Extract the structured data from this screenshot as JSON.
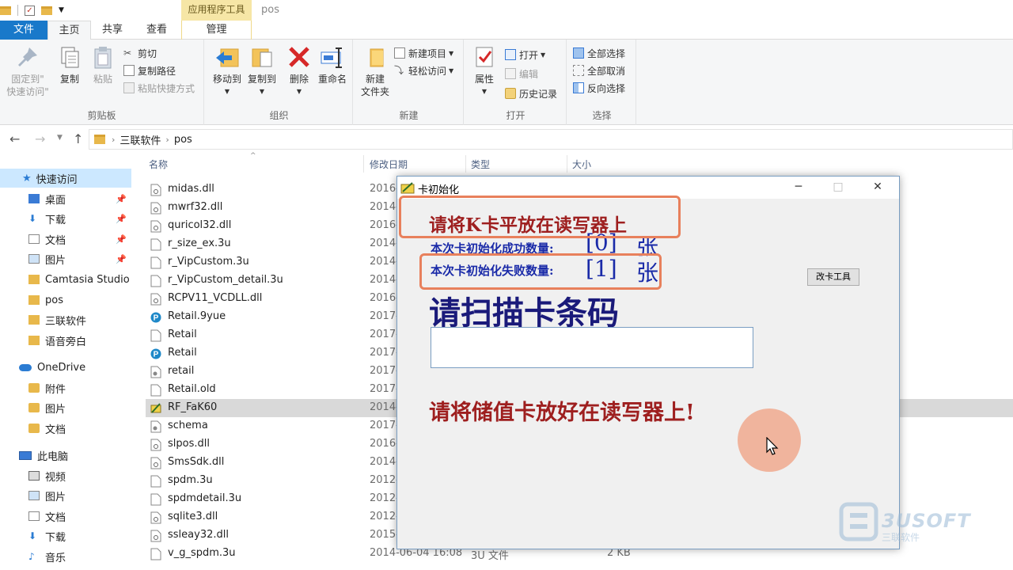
{
  "window": {
    "title": "pos",
    "context_tab": "应用程序工具"
  },
  "tabs": {
    "file": "文件",
    "home": "主页",
    "share": "共享",
    "view": "查看",
    "manage": "管理"
  },
  "ribbon": {
    "clipboard": {
      "label": "剪贴板",
      "pin": "固定到\"\n快速访问\"",
      "pin_l1": "固定到\"",
      "pin_l2": "快速访问\"",
      "copy": "复制",
      "paste": "粘贴",
      "cut": "剪切",
      "copy_path": "复制路径",
      "paste_shortcut": "粘贴快捷方式"
    },
    "organize": {
      "label": "组织",
      "move_to": "移动到",
      "copy_to": "复制到",
      "delete": "删除",
      "rename": "重命名"
    },
    "new": {
      "label": "新建",
      "new_folder_l1": "新建",
      "new_folder_l2": "文件夹",
      "new_item": "新建项目",
      "easy_access": "轻松访问"
    },
    "open": {
      "label": "打开",
      "properties": "属性",
      "open": "打开",
      "edit": "编辑",
      "history": "历史记录"
    },
    "select": {
      "label": "选择",
      "select_all": "全部选择",
      "select_none": "全部取消",
      "invert": "反向选择"
    }
  },
  "address": {
    "crumbs": [
      "三联软件",
      "pos"
    ]
  },
  "nav": {
    "quick_access": "快速访问",
    "items": [
      "桌面",
      "下载",
      "文档",
      "图片",
      "Camtasia Studio",
      "pos",
      "三联软件",
      "语音旁白"
    ],
    "onedrive": "OneDrive",
    "onedrive_items": [
      "附件",
      "图片",
      "文档"
    ],
    "this_pc": "此电脑",
    "pc_items": [
      "视频",
      "图片",
      "文档",
      "下载",
      "音乐"
    ]
  },
  "columns": {
    "name": "名称",
    "date": "修改日期",
    "type": "类型",
    "size": "大小"
  },
  "files": [
    {
      "name": "midas.dll",
      "date": "2016-",
      "type": "",
      "size": "",
      "icon": "dll"
    },
    {
      "name": "mwrf32.dll",
      "date": "2014-",
      "type": "",
      "size": "",
      "icon": "dll"
    },
    {
      "name": "quricol32.dll",
      "date": "2016-",
      "type": "",
      "size": "",
      "icon": "dll"
    },
    {
      "name": "r_size_ex.3u",
      "date": "2014-",
      "type": "",
      "size": "",
      "icon": "file"
    },
    {
      "name": "r_VipCustom.3u",
      "date": "2014-",
      "type": "",
      "size": "",
      "icon": "file"
    },
    {
      "name": "r_VipCustom_detail.3u",
      "date": "2014-",
      "type": "",
      "size": "",
      "icon": "file"
    },
    {
      "name": "RCPV11_VCDLL.dll",
      "date": "2016-",
      "type": "",
      "size": "",
      "icon": "dll"
    },
    {
      "name": "Retail.9yue",
      "date": "2017-",
      "type": "",
      "size": "",
      "icon": "p"
    },
    {
      "name": "Retail",
      "date": "2017-",
      "type": "",
      "size": "",
      "icon": "file"
    },
    {
      "name": "Retail",
      "date": "2017-",
      "type": "",
      "size": "",
      "icon": "p"
    },
    {
      "name": "retail",
      "date": "2017-",
      "type": "",
      "size": "",
      "icon": "cfg"
    },
    {
      "name": "Retail.old",
      "date": "2017-",
      "type": "",
      "size": "",
      "icon": "file"
    },
    {
      "name": "RF_FaK60",
      "date": "2014-",
      "type": "",
      "size": "",
      "icon": "exe"
    },
    {
      "name": "schema",
      "date": "2017-",
      "type": "",
      "size": "",
      "icon": "cfg"
    },
    {
      "name": "slpos.dll",
      "date": "2016-",
      "type": "",
      "size": "",
      "icon": "dll"
    },
    {
      "name": "SmsSdk.dll",
      "date": "2014-",
      "type": "",
      "size": "",
      "icon": "dll"
    },
    {
      "name": "spdm.3u",
      "date": "2012-",
      "type": "",
      "size": "",
      "icon": "file"
    },
    {
      "name": "spdmdetail.3u",
      "date": "2012-",
      "type": "",
      "size": "",
      "icon": "file"
    },
    {
      "name": "sqlite3.dll",
      "date": "2012-",
      "type": "",
      "size": "",
      "icon": "dll"
    },
    {
      "name": "ssleay32.dll",
      "date": "2015-",
      "type": "",
      "size": "",
      "icon": "dll"
    },
    {
      "name": "v_g_spdm.3u",
      "date": "2014-06-04 16:08",
      "type": "3U 文件",
      "size": "2 KB",
      "icon": "file"
    }
  ],
  "selected_file_index": 12,
  "dialog": {
    "title": "卡初始化",
    "line1": "请将K卡平放在读写器上",
    "success_label": "本次卡初始化成功数量:",
    "success_count": "[0]",
    "fail_label": "本次卡初始化失败数量:",
    "fail_count": "[1]",
    "unit": "张",
    "button": "改卡工具",
    "scan_prompt": "请扫描卡条码",
    "hint": "请将储值卡放好在读写器上!"
  },
  "watermark": {
    "brand": "3USOFT",
    "sub": "三联软件"
  },
  "colors": {
    "accent": "#1979ca",
    "red_text": "#9e1f1f",
    "blue_text": "#1a2aa8",
    "highlight": "#e8805c"
  }
}
